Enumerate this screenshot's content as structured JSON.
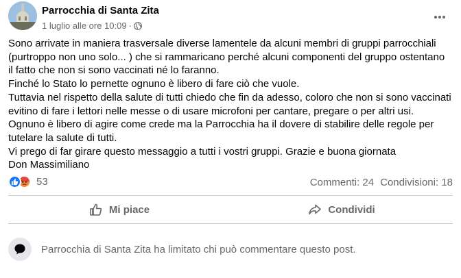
{
  "post": {
    "page_name": "Parrocchia di Santa Zita",
    "timestamp": "1 luglio alle ore 10:09",
    "separator": "·",
    "privacy_icon": "globe-icon",
    "more_icon": "more-dots-icon",
    "text_lines": [
      "Sono arrivate in maniera trasversale diverse lamentele da alcuni membri di gruppi parrocchiali",
      "(purtroppo non uno solo... ) che si rammaricano perché alcuni componenti del gruppo ostentano",
      "il fatto che non si sono vaccinati né lo faranno.",
      "Finché lo Stato lo pernette ognuno è libero di fare ciò che vuole.",
      "Tuttavia nel rispetto della salute di tutti chiedo che fin da adesso, coloro che non si sono vaccinati",
      "evitino di fare i lettori nelle messe o di usare microfoni per cantare, pregare o per altri usi.",
      "Ognuno è libero di agire come crede ma la Parrocchia ha il dovere di stabilire delle regole per",
      "tutelare la salute di tutti.",
      "Vi prego di far girare questo messaggio a tutti i vostri gruppi. Grazie e buona giornata",
      "Don Massimiliano"
    ]
  },
  "stats": {
    "reaction_icons": [
      "like-icon",
      "angry-icon"
    ],
    "reaction_count": "53",
    "comments": "Commenti: 24",
    "shares": "Condivisioni: 18"
  },
  "actions": {
    "like_label": "Mi piace",
    "share_label": "Condividi"
  },
  "comment_notice": {
    "text": "Parrocchia di Santa Zita ha limitato chi può commentare questo post.",
    "icon": "comment-bubble-icon"
  },
  "colors": {
    "text_primary": "#050505",
    "text_secondary": "#65676b",
    "like_blue": "#1877f2",
    "angry_orange": "#f0883e",
    "divider": "#ced0d4"
  }
}
